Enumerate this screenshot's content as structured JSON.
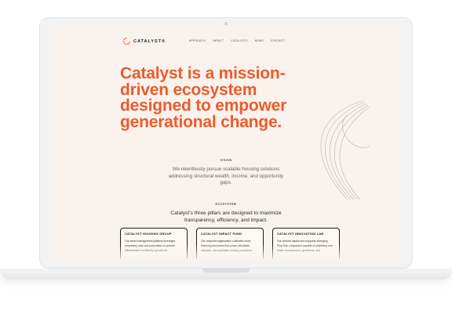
{
  "brand": {
    "name": "CATALYST®",
    "accent": "#ee5a2c"
  },
  "nav": {
    "links": [
      "APPROACH",
      "IMPACT",
      "CATALYSTS",
      "NEWS",
      "CONTACT"
    ]
  },
  "hero": {
    "headline_lines": [
      "Catalyst is a mission-",
      "driven ecosystem",
      "designed to empower",
      "generational change."
    ]
  },
  "vision": {
    "label": "VISION",
    "text": "We relentlessly pursue scalable housing solutions addressing structural wealth, income, and opportunity gaps."
  },
  "ecosystem": {
    "label": "ECOSYSTEM",
    "text": "Catalyst’s three pillars are designed to maximize transparency, efficiency, and impact."
  },
  "cards": [
    {
      "title": "CATALYST HOUSING GROUP",
      "desc": "Our asset management platform leverages proprietary data and automation to provide differentiated multifamily operational"
    },
    {
      "title": "CATALYST IMPACT FUND",
      "desc": "Our nonprofit organization cultivates novel financing structures that power affordable, inclusive, and equitable housing production."
    },
    {
      "title": "CATALYST INNOVATION LAB",
      "desc": "Our venture capital arm supports emerging PropTech companies capable of redefining real estate development, operations, and"
    }
  ]
}
